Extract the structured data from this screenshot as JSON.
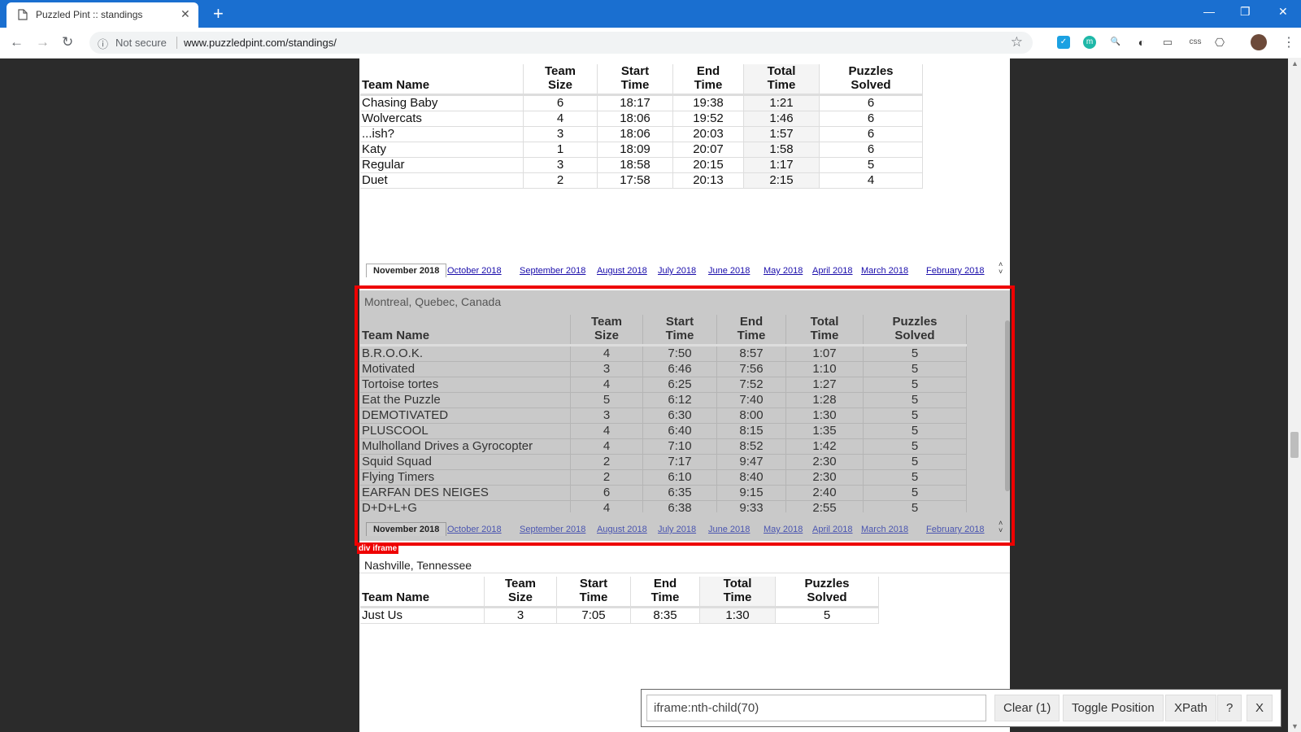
{
  "browser": {
    "tab_title": "Puzzled Pint :: standings",
    "new_tab": "+",
    "min": "—",
    "restore": "❐",
    "close": "✕",
    "not_secure": "Not secure",
    "url": "www.puzzledpint.com/standings/",
    "ext_css": "css",
    "ext_m": "m"
  },
  "columns": {
    "team_name": "Team Name",
    "team_size_1": "Team",
    "team_size_2": "Size",
    "start_1": "Start",
    "start_2": "Time",
    "end_1": "End",
    "end_2": "Time",
    "total_1": "Total",
    "total_2": "Time",
    "solved_1": "Puzzles",
    "solved_2": "Solved"
  },
  "top_table": {
    "rows": [
      [
        "Chasing Baby",
        "6",
        "18:17",
        "19:38",
        "1:21",
        "6"
      ],
      [
        "Wolvercats",
        "4",
        "18:06",
        "19:52",
        "1:46",
        "6"
      ],
      [
        "...ish?",
        "3",
        "18:06",
        "20:03",
        "1:57",
        "6"
      ],
      [
        "Katy",
        "1",
        "18:09",
        "20:07",
        "1:58",
        "6"
      ],
      [
        "Regular",
        "3",
        "18:58",
        "20:15",
        "1:17",
        "5"
      ],
      [
        "Duet",
        "2",
        "17:58",
        "20:13",
        "2:15",
        "4"
      ]
    ]
  },
  "months": {
    "selected": "November 2018",
    "others": [
      "October 2018",
      "September 2018",
      "August 2018",
      "July 2018",
      "June 2018",
      "May 2018",
      "April 2018",
      "March 2018",
      "February 2018"
    ],
    "arrow_up": "˄",
    "arrow_down": "˅"
  },
  "montreal": {
    "region": "Montreal, Quebec, Canada",
    "rows": [
      [
        "B.R.O.O.K.",
        "4",
        "7:50",
        "8:57",
        "1:07",
        "5"
      ],
      [
        "Motivated",
        "3",
        "6:46",
        "7:56",
        "1:10",
        "5"
      ],
      [
        "Tortoise tortes",
        "4",
        "6:25",
        "7:52",
        "1:27",
        "5"
      ],
      [
        "Eat the Puzzle",
        "5",
        "6:12",
        "7:40",
        "1:28",
        "5"
      ],
      [
        "DEMOTIVATED",
        "3",
        "6:30",
        "8:00",
        "1:30",
        "5"
      ],
      [
        "PLUSCOOL",
        "4",
        "6:40",
        "8:15",
        "1:35",
        "5"
      ],
      [
        "Mulholland Drives a Gyrocopter",
        "4",
        "7:10",
        "8:52",
        "1:42",
        "5"
      ],
      [
        "Squid Squad",
        "2",
        "7:17",
        "9:47",
        "2:30",
        "5"
      ],
      [
        "Flying Timers",
        "2",
        "6:10",
        "8:40",
        "2:30",
        "5"
      ],
      [
        "EARFAN DES NEIGES",
        "6",
        "6:35",
        "9:15",
        "2:40",
        "5"
      ],
      [
        "D+D+L+G",
        "4",
        "6:38",
        "9:33",
        "2:55",
        "5"
      ]
    ]
  },
  "highlight_label": "div iframe",
  "nashville": {
    "region": "Nashville, Tennessee",
    "rows": [
      [
        "Just Us",
        "3",
        "7:05",
        "8:35",
        "1:30",
        "5"
      ]
    ]
  },
  "selector_gadget": {
    "selector": "iframe:nth-child(70)",
    "clear": "Clear (1)",
    "toggle": "Toggle Position",
    "xpath": "XPath",
    "help": "?",
    "close": "X"
  }
}
